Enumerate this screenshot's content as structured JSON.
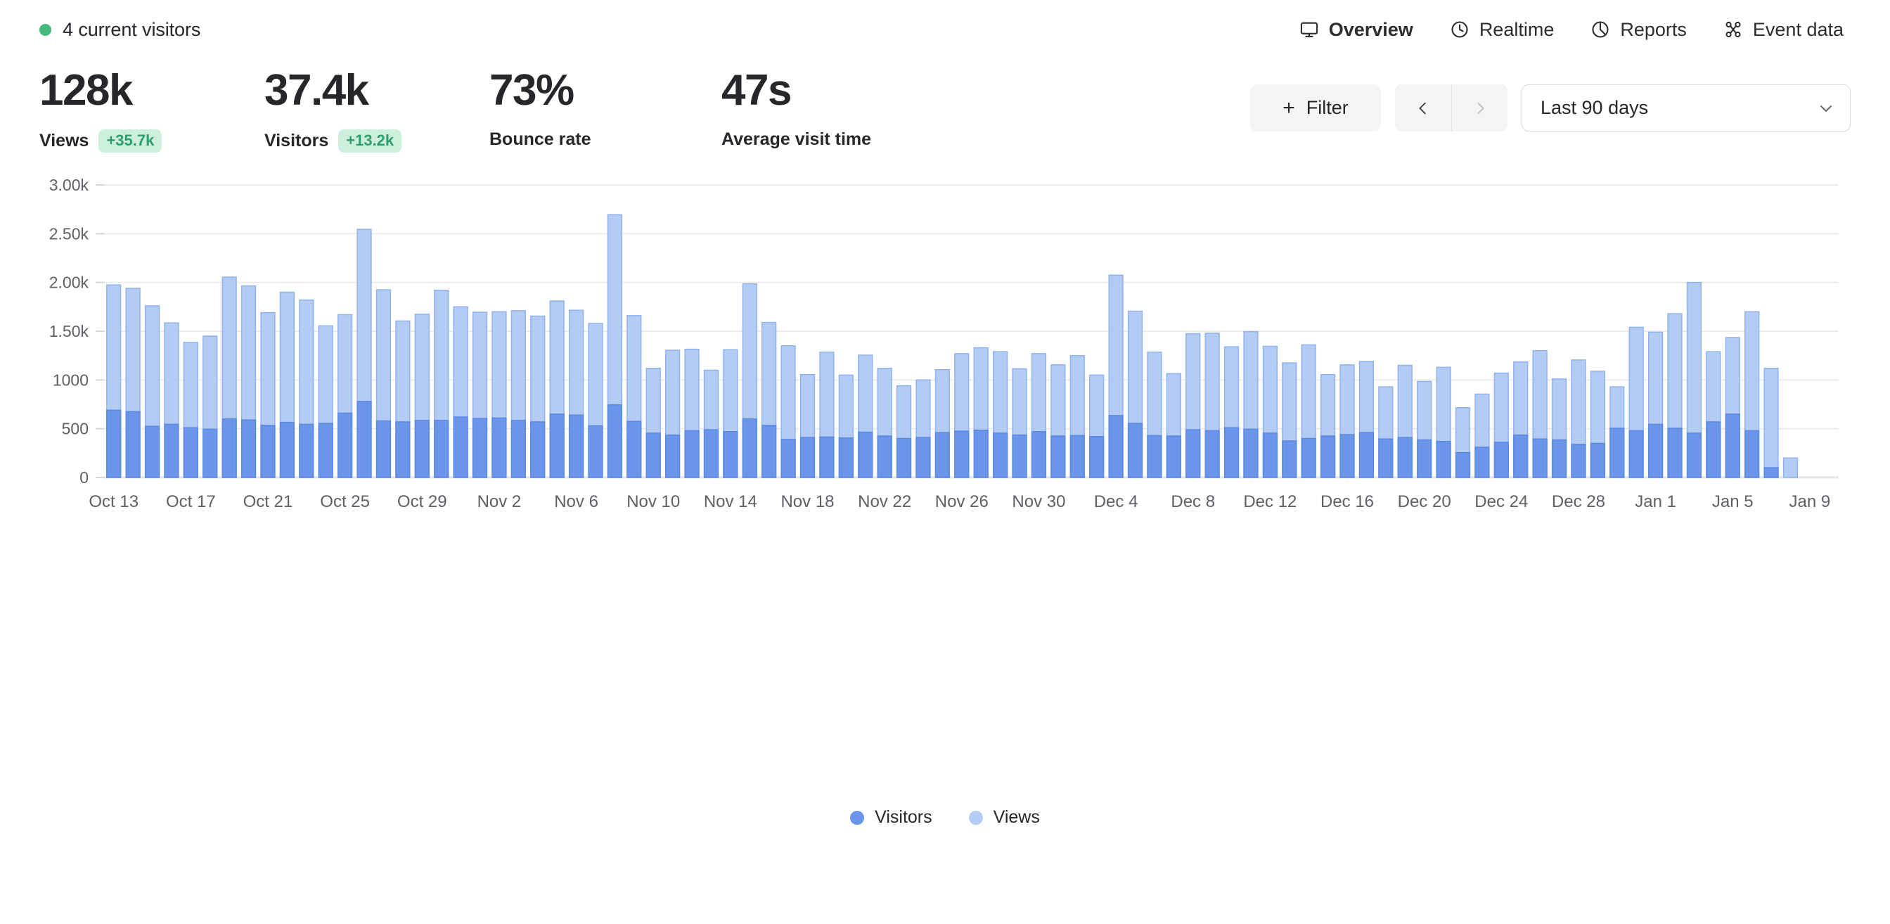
{
  "header": {
    "live_status": "4 current visitors",
    "live_dot_color": "#45b97c",
    "nav": [
      {
        "label": "Overview",
        "icon": "monitor-icon",
        "active": true
      },
      {
        "label": "Realtime",
        "icon": "clock-icon",
        "active": false
      },
      {
        "label": "Reports",
        "icon": "pie-chart-icon",
        "active": false
      },
      {
        "label": "Event data",
        "icon": "nodes-icon",
        "active": false
      }
    ]
  },
  "metrics": [
    {
      "value": "128k",
      "label": "Views",
      "change": "+35.7k"
    },
    {
      "value": "37.4k",
      "label": "Visitors",
      "change": "+13.2k"
    },
    {
      "value": "73%",
      "label": "Bounce rate",
      "change": ""
    },
    {
      "value": "47s",
      "label": "Average visit time",
      "change": ""
    }
  ],
  "controls": {
    "filter_label": "Filter",
    "filter_icon": "plus-icon",
    "prev_icon": "chevron-left-icon",
    "next_icon": "chevron-right-icon",
    "next_disabled": true,
    "date_range": "Last 90 days",
    "date_caret_icon": "chevron-down-icon"
  },
  "legend": [
    {
      "label": "Visitors",
      "color": "#6a95e8"
    },
    {
      "label": "Views",
      "color": "#b4cbf3"
    }
  ],
  "chart_data": {
    "type": "bar",
    "title": "",
    "xlabel": "",
    "ylabel": "",
    "ylim": [
      0,
      3000
    ],
    "grid": true,
    "legend_position": "bottom",
    "bar_mode": "overlay",
    "y_ticks": [
      0,
      500,
      1000,
      1500,
      2000,
      2500,
      3000
    ],
    "y_tick_labels": [
      "0",
      "500",
      "1000",
      "1.50k",
      "2.00k",
      "2.50k",
      "3.00k"
    ],
    "x_tick_labels": [
      "Oct 13",
      "Oct 17",
      "Oct 21",
      "Oct 25",
      "Oct 29",
      "Nov 2",
      "Nov 6",
      "Nov 10",
      "Nov 14",
      "Nov 18",
      "Nov 22",
      "Nov 26",
      "Nov 30",
      "Dec 4",
      "Dec 8",
      "Dec 12",
      "Dec 16",
      "Dec 20",
      "Dec 24",
      "Dec 28",
      "Jan 1",
      "Jan 5",
      "Jan 9"
    ],
    "x_tick_indices": [
      0,
      4,
      8,
      12,
      16,
      20,
      24,
      28,
      32,
      36,
      40,
      44,
      48,
      52,
      56,
      60,
      64,
      68,
      72,
      76,
      80,
      84,
      88
    ],
    "categories": [
      "Oct 13",
      "Oct 14",
      "Oct 15",
      "Oct 16",
      "Oct 17",
      "Oct 18",
      "Oct 19",
      "Oct 20",
      "Oct 21",
      "Oct 22",
      "Oct 23",
      "Oct 24",
      "Oct 25",
      "Oct 26",
      "Oct 27",
      "Oct 28",
      "Oct 29",
      "Oct 30",
      "Oct 31",
      "Nov 1",
      "Nov 2",
      "Nov 3",
      "Nov 4",
      "Nov 5",
      "Nov 6",
      "Nov 7",
      "Nov 8",
      "Nov 9",
      "Nov 10",
      "Nov 11",
      "Nov 12",
      "Nov 13",
      "Nov 14",
      "Nov 15",
      "Nov 16",
      "Nov 17",
      "Nov 18",
      "Nov 19",
      "Nov 20",
      "Nov 21",
      "Nov 22",
      "Nov 23",
      "Nov 24",
      "Nov 25",
      "Nov 26",
      "Nov 27",
      "Nov 28",
      "Nov 29",
      "Nov 30",
      "Dec 1",
      "Dec 2",
      "Dec 3",
      "Dec 4",
      "Dec 5",
      "Dec 6",
      "Dec 7",
      "Dec 8",
      "Dec 9",
      "Dec 10",
      "Dec 11",
      "Dec 12",
      "Dec 13",
      "Dec 14",
      "Dec 15",
      "Dec 16",
      "Dec 17",
      "Dec 18",
      "Dec 19",
      "Dec 20",
      "Dec 21",
      "Dec 22",
      "Dec 23",
      "Dec 24",
      "Dec 25",
      "Dec 26",
      "Dec 27",
      "Dec 28",
      "Dec 29",
      "Dec 30",
      "Dec 31",
      "Jan 1",
      "Jan 2",
      "Jan 3",
      "Jan 4",
      "Jan 5",
      "Jan 6",
      "Jan 7",
      "Jan 8",
      "Jan 9",
      "Jan 10"
    ],
    "series": [
      {
        "name": "Views",
        "color": "#b4cbf3",
        "values": [
          1975,
          1940,
          1760,
          1585,
          1385,
          1450,
          2055,
          1965,
          1690,
          1900,
          1820,
          1555,
          1670,
          2545,
          1925,
          1605,
          1675,
          1920,
          1750,
          1695,
          1700,
          1710,
          1655,
          1810,
          1715,
          1580,
          2695,
          1660,
          1120,
          1305,
          1315,
          1100,
          1310,
          1985,
          1590,
          1350,
          1055,
          1285,
          1050,
          1255,
          1120,
          940,
          1000,
          1105,
          1270,
          1330,
          1290,
          1115,
          1270,
          1155,
          1250,
          1050,
          2075,
          1705,
          1285,
          1065,
          1475,
          1480,
          1340,
          1495,
          1345,
          1175,
          1360,
          1055,
          1155,
          1190,
          930,
          1150,
          985,
          1130,
          715,
          855,
          1070,
          1185,
          1300,
          1010,
          1205,
          1090,
          930,
          1540,
          1490,
          1680,
          2000,
          1290,
          1435,
          1700,
          1120,
          200
        ]
      },
      {
        "name": "Visitors",
        "color": "#6a95e8",
        "values": [
          690,
          675,
          525,
          545,
          510,
          495,
          600,
          590,
          535,
          565,
          545,
          555,
          660,
          780,
          580,
          570,
          585,
          585,
          620,
          605,
          610,
          585,
          570,
          650,
          640,
          530,
          745,
          575,
          455,
          435,
          480,
          490,
          470,
          600,
          535,
          390,
          410,
          415,
          405,
          465,
          425,
          400,
          410,
          460,
          475,
          485,
          455,
          435,
          470,
          425,
          430,
          420,
          635,
          555,
          430,
          425,
          490,
          480,
          510,
          495,
          455,
          375,
          400,
          425,
          440,
          460,
          395,
          410,
          385,
          370,
          255,
          310,
          360,
          435,
          395,
          385,
          340,
          350,
          505,
          480,
          545,
          505,
          455,
          570,
          650,
          480,
          100
        ]
      }
    ]
  }
}
